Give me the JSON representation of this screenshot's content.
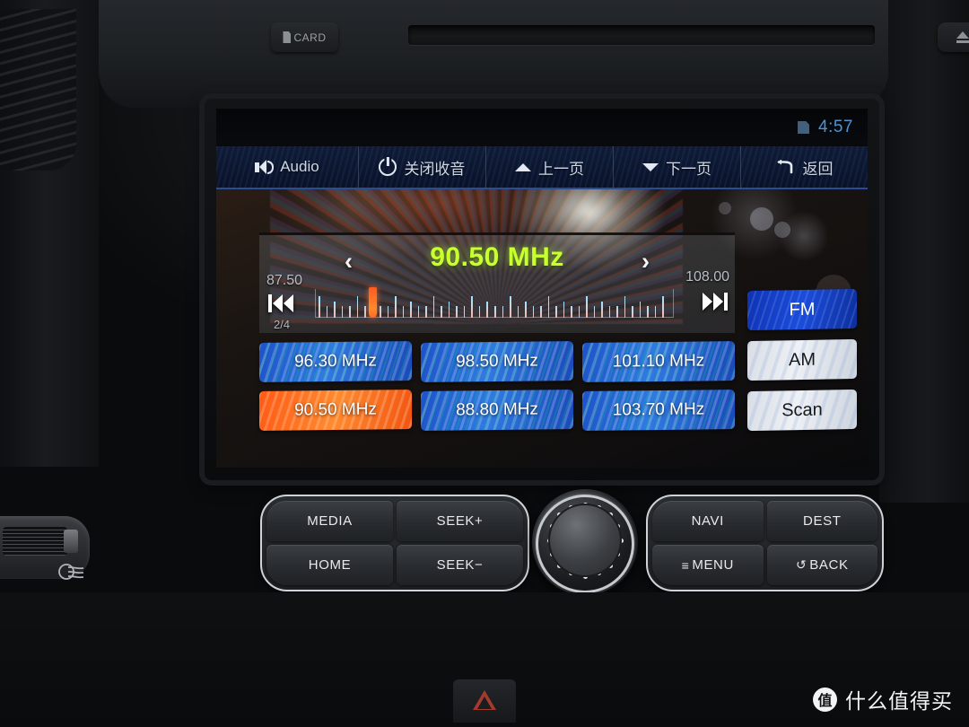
{
  "hardware": {
    "card_button": {
      "label": "CARD",
      "icon": "sd-card-icon"
    },
    "eject_button": {
      "icon": "eject-icon"
    },
    "buttons_left": [
      {
        "id": "media",
        "label": "MEDIA"
      },
      {
        "id": "seek-up",
        "label": "SEEK+"
      },
      {
        "id": "home",
        "label": "HOME"
      },
      {
        "id": "seek-down",
        "label": "SEEK−"
      }
    ],
    "buttons_right": [
      {
        "id": "navi",
        "label": "NAVI"
      },
      {
        "id": "dest",
        "label": "DEST"
      },
      {
        "id": "menu",
        "label": "MENU",
        "glyph": "≡"
      },
      {
        "id": "back",
        "label": "BACK",
        "glyph": "↺"
      }
    ],
    "knob": {
      "name": "rotary-knob"
    }
  },
  "screen": {
    "statusbar": {
      "time": "4:57",
      "icon": "sd-card-status-icon"
    },
    "navbar": [
      {
        "id": "audio",
        "label": "Audio",
        "icon": "speaker-icon"
      },
      {
        "id": "radio-off",
        "label": "关闭收音",
        "icon": "power-icon"
      },
      {
        "id": "page-up",
        "label": "上一页",
        "icon": "chevron-up-icon"
      },
      {
        "id": "page-down",
        "label": "下一页",
        "icon": "chevron-down-icon"
      },
      {
        "id": "back",
        "label": "返回",
        "icon": "back-arrow-icon"
      }
    ],
    "tuner": {
      "current_frequency": "90.50 MHz",
      "band_min": "87.50",
      "band_max": "108.00",
      "page_indicator": "2/4",
      "arrow_left": "‹",
      "arrow_right": "›",
      "prev_icon": "skip-previous-icon",
      "next_icon": "skip-next-icon",
      "marker_position_pct": 15.4,
      "freq_color": "#c8ff2e"
    },
    "presets": [
      [
        {
          "label": "96.30 MHz",
          "state": "inactive"
        },
        {
          "label": "98.50 MHz",
          "state": "inactive"
        },
        {
          "label": "101.10 MHz",
          "state": "inactive"
        }
      ],
      [
        {
          "label": "90.50 MHz",
          "state": "active"
        },
        {
          "label": "88.80 MHz",
          "state": "inactive"
        },
        {
          "label": "103.70 MHz",
          "state": "inactive"
        }
      ]
    ],
    "bands": [
      {
        "label": "FM",
        "state": "active"
      },
      {
        "label": "AM",
        "state": "inactive"
      },
      {
        "label": "Scan",
        "state": "inactive"
      }
    ],
    "colors": {
      "accent_blue": "#1d53c8",
      "active_orange": "#ff5a14",
      "freq_green": "#c8ff2e",
      "time_blue": "#4d93d6"
    }
  },
  "watermark": {
    "logo_char": "值",
    "text": "什么值得买"
  }
}
